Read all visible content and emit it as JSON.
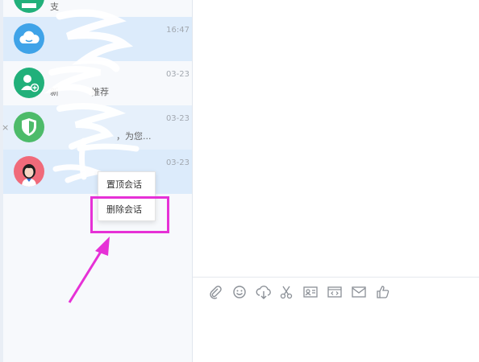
{
  "conversations": [
    {
      "name": "",
      "message": "支",
      "time": ""
    },
    {
      "name": "",
      "message": "",
      "time": "16:47"
    },
    {
      "name": "",
      "message": "新",
      "time": "03-23",
      "message_tail": "推荐"
    },
    {
      "name": "",
      "message": "",
      "time": "03-23",
      "message_tail": "，为您..."
    },
    {
      "name": "",
      "message": "",
      "time": "03-23"
    }
  ],
  "close_glyph": "×",
  "context_menu": {
    "pin_label": "置顶会话",
    "delete_label": "删除会话"
  },
  "toolbar": {
    "icons": [
      "paperclip-icon",
      "emoji-icon",
      "cloud-upload-icon",
      "scissors-icon",
      "contact-card-icon",
      "code-icon",
      "mail-icon",
      "thumbs-up-icon"
    ]
  },
  "colors": {
    "green_avatar": "#21b07a",
    "blue_avatar": "#3fa3e8",
    "selected_row": "#dcebfb",
    "annotation_magenta": "#e631d6"
  }
}
